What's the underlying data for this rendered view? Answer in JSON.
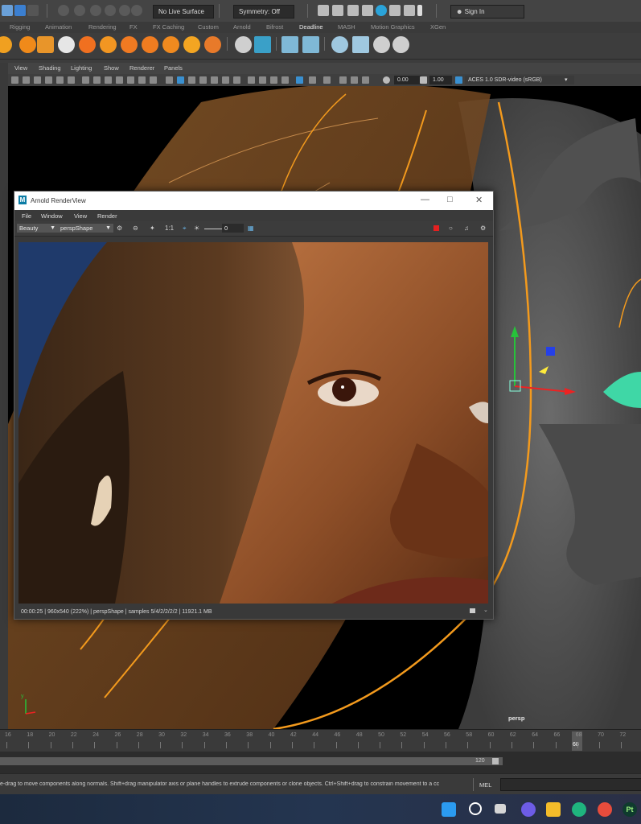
{
  "status_line": {
    "live_surface": "No Live Surface",
    "symmetry": "Symmetry: Off",
    "sign_in": "Sign In"
  },
  "shelf_tabs": [
    "Rigging",
    "Animation",
    "Rendering",
    "FX",
    "FX Caching",
    "Custom",
    "Arnold",
    "Bifrost",
    "Deadline",
    "MASH",
    "Motion Graphics",
    "XGen"
  ],
  "shelf_active_tab": "Deadline",
  "panel_menu": [
    "View",
    "Shading",
    "Lighting",
    "Show",
    "Renderer",
    "Panels"
  ],
  "panel_toolbar": {
    "exposure": "0.00",
    "gamma": "1.00",
    "color_space": "ACES 1.0 SDR-video (sRGB)"
  },
  "viewport": {
    "camera_label": "persp"
  },
  "render_view": {
    "title": "Arnold RenderView",
    "menu": [
      "File",
      "Window",
      "View",
      "Render"
    ],
    "aov": "Beauty",
    "camera": "perspShape",
    "ratio": "1:1",
    "exposure": "0",
    "status": "00:00:25 | 960x540 (222%) | perspShape  | samples 5/4/2/2/2/2 | 11921.1 MB"
  },
  "time_slider": {
    "ticks": [
      "16",
      "18",
      "20",
      "22",
      "24",
      "26",
      "28",
      "30",
      "32",
      "34",
      "36",
      "38",
      "40",
      "42",
      "44",
      "46",
      "48",
      "50",
      "52",
      "54",
      "56",
      "58",
      "60",
      "62",
      "64",
      "66",
      "68",
      "70",
      "72"
    ],
    "current_frame": "68"
  },
  "range_slider": {
    "end_frame": "120"
  },
  "help_line": {
    "text": "e-drag to move components along normals. Shift+drag manipulator axis or plane handles to extrude components or clone objects. Ctrl+Shift+drag to constrain movement to a cc",
    "mel_label": "MEL"
  },
  "taskbar": {
    "icons": [
      "windows-start-icon",
      "search-icon",
      "task-view-icon",
      "teams-chat-icon",
      "file-explorer-icon",
      "edge-browser-icon",
      "chrome-browser-icon",
      "substance-painter-icon"
    ]
  }
}
